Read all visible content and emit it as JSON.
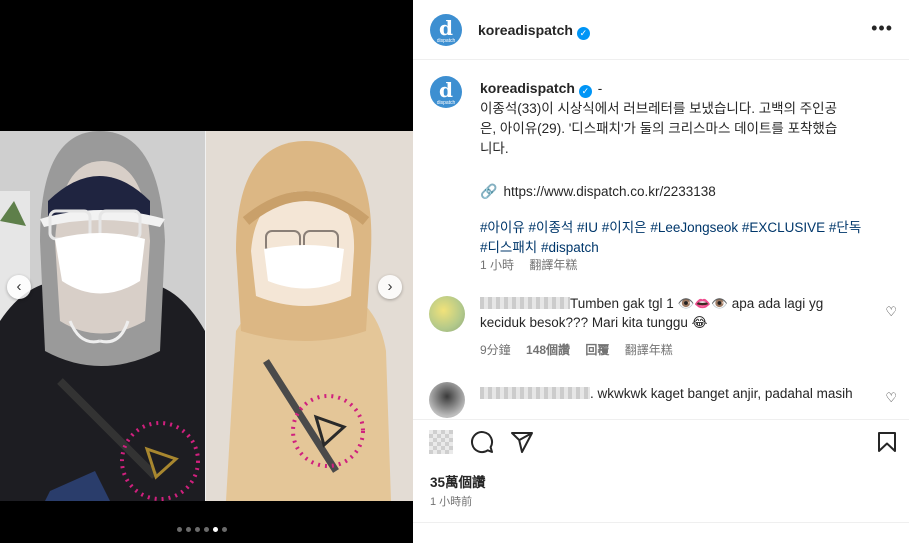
{
  "post": {
    "username": "koreadispatch",
    "avatar_letter": "d",
    "avatar_sub": "dispatch",
    "verified": true,
    "more_label": "•••",
    "caption_suffix": "-",
    "caption_lines": [
      "이종석(33)이 시상식에서 러브레터를 보냈습니다. 고백의 주인공",
      "은, 아이유(29). '디스패치'가 둘의 크리스마스 데이트를 포착했습",
      "니다."
    ],
    "link": "https://www.dispatch.co.kr/2233138",
    "hashtags_line1": "#아이유 #이종석 #IU #이지은 #LeeJongseok #EXCLUSIVE #단독",
    "hashtags_line2": "#디스패치 #dispatch",
    "caption_time": "1 小時",
    "caption_translate": "翻譯年糕"
  },
  "comments": [
    {
      "text_line1": "Tumben gak tgl 1 👁️👄👁️ apa ada lagi yg",
      "text_line2": "keciduk besok??? Mari kita tunggu 😂",
      "time": "9分鐘",
      "likes": "148個讚",
      "reply": "回覆",
      "translate": "翻譯年糕"
    },
    {
      "text_line1": ". wkwkwk kaget banget anjir, padahal masih"
    }
  ],
  "footer": {
    "likes": "35萬個讚",
    "time": "1 小時前"
  },
  "carousel": {
    "dots": 6,
    "active": 5
  },
  "colors": {
    "accent_link": "#00376b",
    "verified_blue": "#0095f6",
    "avatar_blue": "#3d8fd1",
    "highlight_magenta": "#d0207e"
  },
  "icons": [
    "more-icon",
    "link-icon",
    "heart-icon",
    "comment-icon",
    "share-icon",
    "bookmark-icon",
    "like-icon",
    "chevron-left-icon",
    "chevron-right-icon"
  ]
}
